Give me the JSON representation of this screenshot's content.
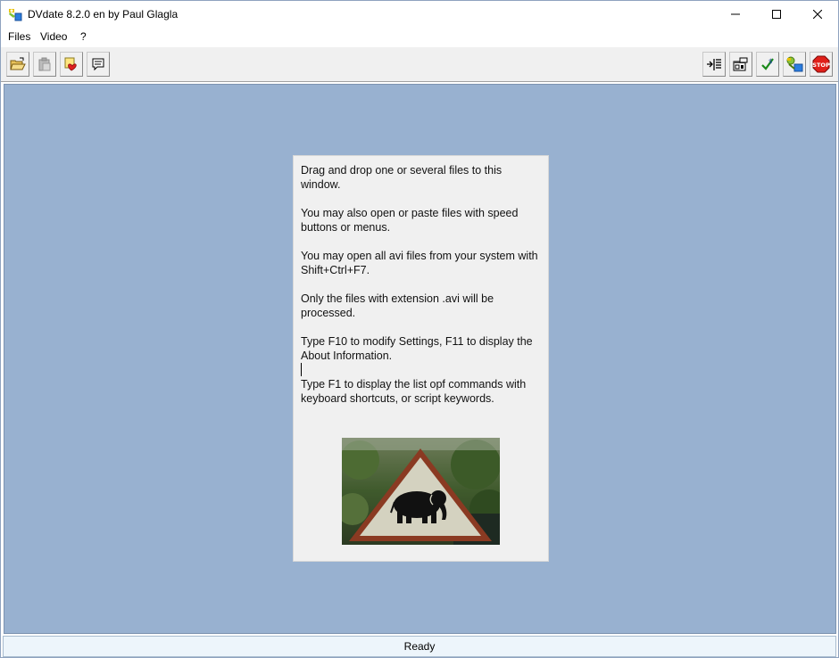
{
  "window": {
    "title": "DVdate 8.2.0 en by Paul Glagla"
  },
  "menu": {
    "items": [
      {
        "label": "Files"
      },
      {
        "label": "Video"
      },
      {
        "label": "?"
      }
    ]
  },
  "panel": {
    "paragraphs": [
      "Drag and drop one or several files to this window.",
      "You may also open or paste files with speed buttons or menus.",
      "You may open all avi files from your system with Shift+Ctrl+F7.",
      "Only the files with extension .avi will be processed.",
      "Type F10 to modify Settings, F11 to display the About Information.",
      "Type F1 to display the list opf commands with keyboard shortcuts, or script keywords."
    ]
  },
  "status": {
    "text": "Ready"
  },
  "colors": {
    "workspace": "#98b1d0",
    "stop": "#e0201a",
    "check": "#1a8a1a"
  }
}
